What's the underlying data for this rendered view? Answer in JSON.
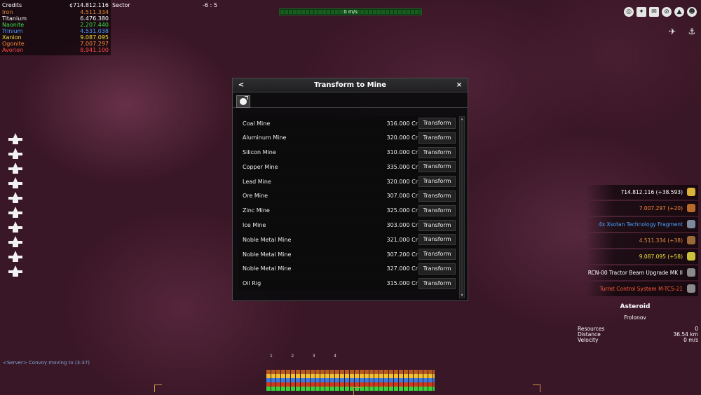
{
  "resources": {
    "credits_label": "Credits",
    "credits_value": "¢714.812.116",
    "sector_label": "Sector",
    "sector_value": "-6 : 5",
    "items": [
      {
        "name": "Iron",
        "value": "4.511.334",
        "color": "#e08a3c"
      },
      {
        "name": "Titanium",
        "value": "6.476.380",
        "color": "#ffffff"
      },
      {
        "name": "Naonite",
        "value": "2.207.440",
        "color": "#3de04a"
      },
      {
        "name": "Trinium",
        "value": "4.531.038",
        "color": "#4a9cff"
      },
      {
        "name": "Xanion",
        "value": "9.087.095",
        "color": "#f2e23c"
      },
      {
        "name": "Ogonite",
        "value": "7.007.297",
        "color": "#ff8a3c"
      },
      {
        "name": "Avorion",
        "value": "8.941.100",
        "color": "#ff4a4a"
      }
    ]
  },
  "hud": {
    "speed": "0 m/s",
    "chat_message": "<Server> Convoy moving to (3:37)"
  },
  "dialog": {
    "title": "Transform to Mine",
    "back": "<",
    "close": "×",
    "button_label": "Transform",
    "rows": [
      {
        "name": "Coal Mine",
        "price": "316.000 Cr"
      },
      {
        "name": "Aluminum Mine",
        "price": "320.000 Cr"
      },
      {
        "name": "Silicon Mine",
        "price": "310.000 Cr"
      },
      {
        "name": "Copper Mine",
        "price": "335.000 Cr"
      },
      {
        "name": "Lead Mine",
        "price": "320.000 Cr"
      },
      {
        "name": "Ore Mine",
        "price": "307.000 Cr"
      },
      {
        "name": "Zinc Mine",
        "price": "325.000 Cr"
      },
      {
        "name": "Ice Mine",
        "price": "303.000 Cr"
      },
      {
        "name": "Noble Metal Mine",
        "price": "321.000 Cr"
      },
      {
        "name": "Noble Metal Mine",
        "price": "307.200 Cr"
      },
      {
        "name": "Noble Metal Mine",
        "price": "327.000 Cr"
      },
      {
        "name": "Oil Rig",
        "price": "315.000 Cr"
      }
    ]
  },
  "notifications": [
    {
      "text": "714.812.116 (+38.593)",
      "color": "#ffffff",
      "icon": "credits-icon",
      "icon_color": "#d9b23a"
    },
    {
      "text": "7.007.297 (+20)",
      "color": "#ff8a3c",
      "icon": "ogonite-icon",
      "icon_color": "#b86a2a"
    },
    {
      "text": "4x Xsotan Technology Fragment",
      "color": "#4aa3ff",
      "icon": "fragment-icon",
      "icon_color": "#7a8a9a"
    },
    {
      "text": "4.511.334 (+38)",
      "color": "#e08a3c",
      "icon": "iron-icon",
      "icon_color": "#9a6a3a"
    },
    {
      "text": "9.087.095 (+58)",
      "color": "#f2e23c",
      "icon": "xanion-icon",
      "icon_color": "#c9c23a"
    },
    {
      "text": "RCN-00 Tractor Beam Upgrade MK II",
      "color": "#ffffff",
      "icon": "upgrade-icon",
      "icon_color": "#8a8a8a"
    },
    {
      "text": "Turret Control System M-TCS-21",
      "color": "#ff5a3c",
      "icon": "turret-system-icon",
      "icon_color": "#8a8a8a"
    }
  ],
  "target": {
    "name": "Asteroid",
    "faction": "Frolonov",
    "resources_label": "Resources",
    "resources_value": "0",
    "distance_label": "Distance",
    "distance_value": "36.54 km",
    "velocity_label": "Velocity",
    "velocity_value": "0 m/s"
  },
  "slots": [
    "1",
    "2",
    "3",
    "4"
  ],
  "fleet_count": 10
}
